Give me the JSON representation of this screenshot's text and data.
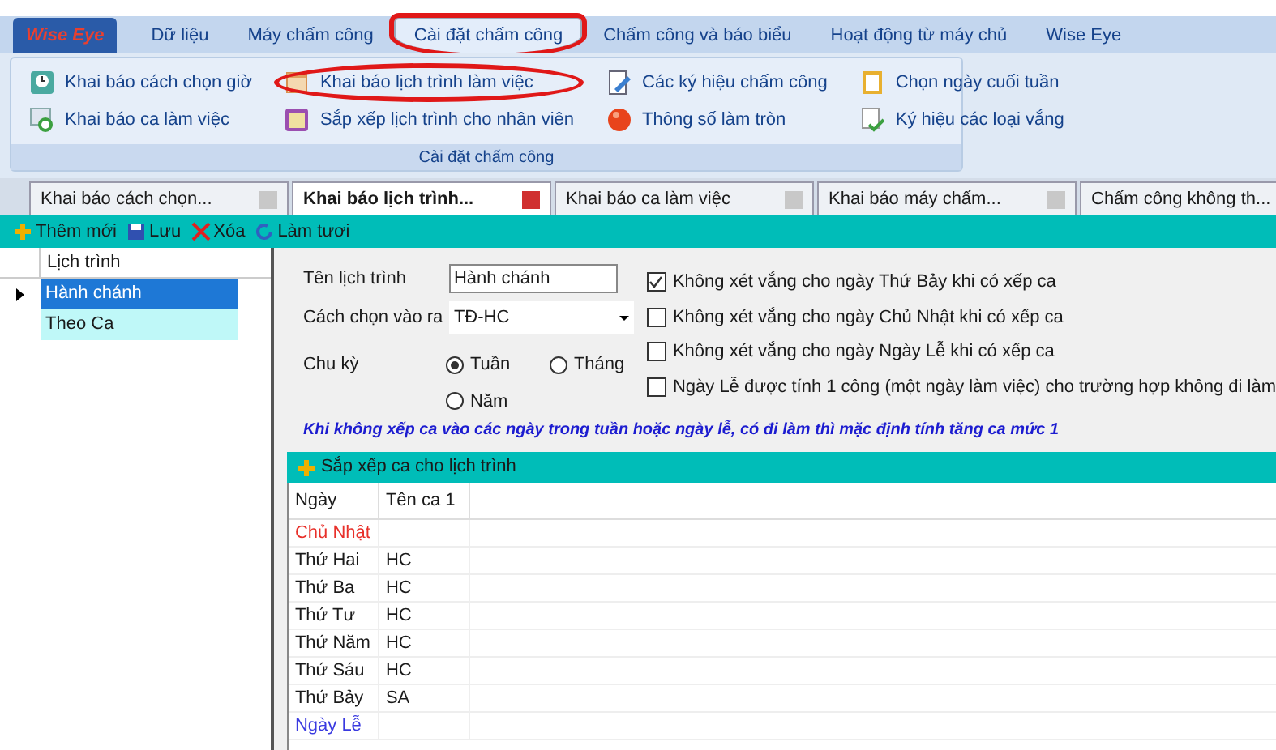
{
  "menu": {
    "logo": "Wise Eye",
    "items": [
      {
        "label": "Dữ liệu",
        "selected": false,
        "circled": false
      },
      {
        "label": "Máy chấm công",
        "selected": false,
        "circled": false
      },
      {
        "label": "Cài đặt chấm công",
        "selected": true,
        "circled": true
      },
      {
        "label": "Chấm công và báo biểu",
        "selected": false,
        "circled": false
      },
      {
        "label": "Hoạt động từ máy chủ",
        "selected": false,
        "circled": false
      },
      {
        "label": "Wise Eye",
        "selected": false,
        "circled": false
      }
    ]
  },
  "ribbon": {
    "group_title": "Cài đặt chấm công",
    "columns": [
      [
        {
          "label": "Khai báo cách chọn giờ",
          "kind": "clock",
          "circled": false
        },
        {
          "label": "Khai báo ca làm việc",
          "kind": "shift",
          "circled": false
        }
      ],
      [
        {
          "label": "Khai báo lịch trình làm việc",
          "kind": "calendar",
          "circled": true
        },
        {
          "label": "Sắp xếp lịch trình cho nhân viên",
          "kind": "board",
          "circled": false
        }
      ],
      [
        {
          "label": "Các ký hiệu chấm công",
          "kind": "symbols",
          "circled": false
        },
        {
          "label": "Thông số làm tròn",
          "kind": "ball",
          "circled": false
        }
      ],
      [
        {
          "label": "Chọn ngày cuối tuần",
          "kind": "notepad",
          "circled": false
        },
        {
          "label": "Ký hiệu các loại vắng",
          "kind": "check",
          "circled": false
        }
      ]
    ]
  },
  "doc_tabs": [
    {
      "label": "Khai báo cách chọn...",
      "selected": false
    },
    {
      "label": "Khai báo lịch trình...",
      "selected": true
    },
    {
      "label": "Khai báo ca làm việc",
      "selected": false
    },
    {
      "label": "Khai báo máy chấm...",
      "selected": false
    },
    {
      "label": "Chấm công không th...",
      "selected": false
    }
  ],
  "toolbar": [
    {
      "label": "Thêm mới",
      "kind": "add"
    },
    {
      "label": "Lưu",
      "kind": "save"
    },
    {
      "label": "Xóa",
      "kind": "delete"
    },
    {
      "label": "Làm tươi",
      "kind": "refresh"
    }
  ],
  "schedule_list": {
    "column": "Lịch trình",
    "rows": [
      {
        "label": "Hành chánh",
        "selected": true
      },
      {
        "label": "Theo Ca",
        "selected": false
      }
    ]
  },
  "form": {
    "name_label": "Tên lịch trình",
    "name_value": "Hành chánh",
    "mode_label": "Cách chọn vào ra",
    "mode_value": "TĐ-HC",
    "cycle_label": "Chu kỳ",
    "cycle_options": [
      {
        "label": "Tuần",
        "selected": true
      },
      {
        "label": "Tháng",
        "selected": false
      },
      {
        "label": "Năm",
        "selected": false
      }
    ],
    "checkboxes": [
      {
        "label": "Không xét vắng cho ngày Thứ Bảy khi có xếp ca",
        "checked": true
      },
      {
        "label": "Không xét vắng cho ngày Chủ Nhật khi có xếp ca",
        "checked": false
      },
      {
        "label": "Không xét vắng cho ngày Ngày Lễ khi có xếp ca",
        "checked": false
      },
      {
        "label": "Ngày Lễ được tính 1 công (một ngày làm việc) cho trường hợp không đi làm",
        "checked": false
      }
    ],
    "note": "Khi không xếp ca vào các ngày trong tuần hoặc ngày lễ, có đi làm thì mặc định tính tăng ca mức 1"
  },
  "shift_grid": {
    "toolbar_label": "Sắp xếp ca cho lịch trình",
    "columns": [
      "Ngày",
      "Tên ca 1"
    ],
    "rows": [
      {
        "day": "Chủ Nhật",
        "shift": "",
        "color": "#e8302a"
      },
      {
        "day": "Thứ Hai",
        "shift": "HC",
        "color": "#1a1a1a"
      },
      {
        "day": "Thứ Ba",
        "shift": "HC",
        "color": "#1a1a1a"
      },
      {
        "day": "Thứ Tư",
        "shift": "HC",
        "color": "#1a1a1a"
      },
      {
        "day": "Thứ Năm",
        "shift": "HC",
        "color": "#1a1a1a"
      },
      {
        "day": "Thứ Sáu",
        "shift": "HC",
        "color": "#1a1a1a"
      },
      {
        "day": "Thứ Bảy",
        "shift": "SA",
        "color": "#1a1a1a"
      },
      {
        "day": "Ngày Lễ",
        "shift": "",
        "color": "#3a3ae0"
      }
    ]
  }
}
